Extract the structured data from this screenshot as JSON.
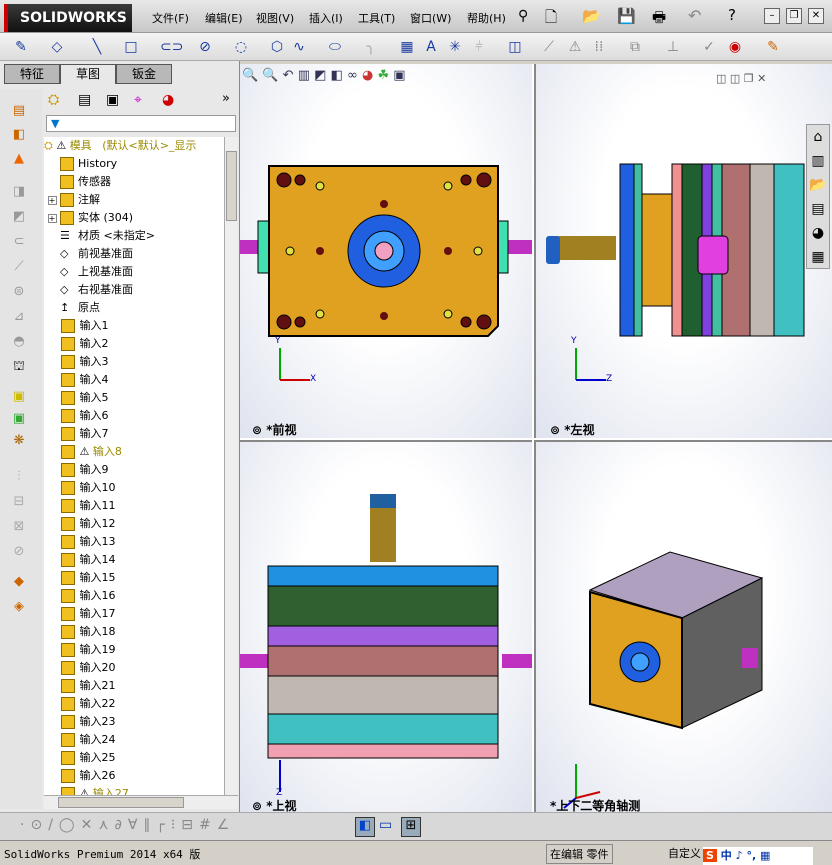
{
  "app": {
    "logo": "SOLIDWORKS"
  },
  "menu": [
    "文件(F)",
    "编辑(E)",
    "视图(V)",
    "插入(I)",
    "工具(T)",
    "窗口(W)",
    "帮助(H)"
  ],
  "tabs": [
    "特征",
    "草图",
    "钣金"
  ],
  "tree": {
    "root": "模具",
    "root_config": "(默认<默认>_显示",
    "items": [
      {
        "label": "History",
        "expand": false
      },
      {
        "label": "传感器",
        "expand": false
      },
      {
        "label": "注解",
        "expand": true
      },
      {
        "label": "实体 (304)",
        "expand": true
      },
      {
        "label": "材质 <未指定>",
        "expand": false
      },
      {
        "label": "前视基准面",
        "expand": false
      },
      {
        "label": "上视基准面",
        "expand": false
      },
      {
        "label": "右视基准面",
        "expand": false
      },
      {
        "label": "原点",
        "expand": false
      }
    ],
    "imports": [
      "输入1",
      "输入2",
      "输入3",
      "输入4",
      "输入5",
      "输入6",
      "输入7",
      "输入8",
      "输入9",
      "输入10",
      "输入11",
      "输入12",
      "输入13",
      "输入14",
      "输入15",
      "输入16",
      "输入17",
      "输入18",
      "输入19",
      "输入20",
      "输入21",
      "输入22",
      "输入23",
      "输入24",
      "输入25",
      "输入26",
      "输入27"
    ],
    "warning_imports": [
      "输入8",
      "输入27"
    ]
  },
  "views": {
    "front": "*前视",
    "left": "*左视",
    "top": "*上视",
    "iso": "*上下二等角轴测"
  },
  "axes": {
    "x": "X",
    "y": "Y",
    "z": "Z"
  },
  "status": {
    "product": "SolidWorks Premium 2014 x64 版",
    "mode": "在编辑 零件",
    "custom": "自定义",
    "ime": "中"
  }
}
